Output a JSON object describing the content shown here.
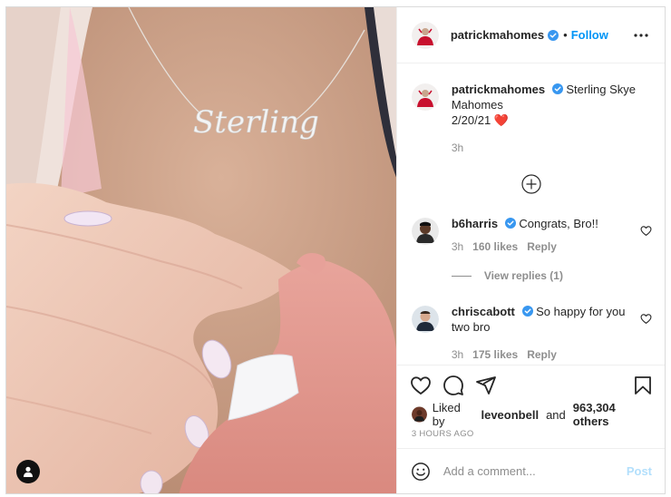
{
  "post": {
    "author": "patrickmahomes",
    "follow_label": "Follow",
    "separator": "•",
    "caption": "Sterling Skye Mahomes",
    "caption_date": "2/20/21",
    "caption_heart": "❤️",
    "caption_age": "3h",
    "necklace_text": "Sterling"
  },
  "comments": [
    {
      "user": "b6harris",
      "text": "Congrats, Bro!!",
      "age": "3h",
      "likes": "160 likes",
      "reply_label": "Reply",
      "view_replies": "View replies (1)"
    },
    {
      "user": "chriscabott",
      "text": "So happy for you two bro",
      "age": "3h",
      "likes": "175 likes",
      "reply_label": "Reply"
    }
  ],
  "likes_line": {
    "prefix": "Liked by",
    "user": "leveonbell",
    "joiner": "and",
    "count": "963,304 others"
  },
  "timestamp": "3 HOURS AGO",
  "composer": {
    "placeholder": "Add a comment...",
    "post_label": "Post"
  },
  "colors": {
    "link_blue": "#0095f6",
    "verified_blue": "#3897f0",
    "muted": "#8e8e8e",
    "post_disabled": "#b2dffc",
    "border": "#dbdbdb"
  },
  "icons": [
    "user-tag-icon",
    "verified-icon",
    "more-options-icon",
    "load-more-icon",
    "heart-icon",
    "comment-icon",
    "share-icon",
    "bookmark-icon",
    "emoji-icon"
  ]
}
